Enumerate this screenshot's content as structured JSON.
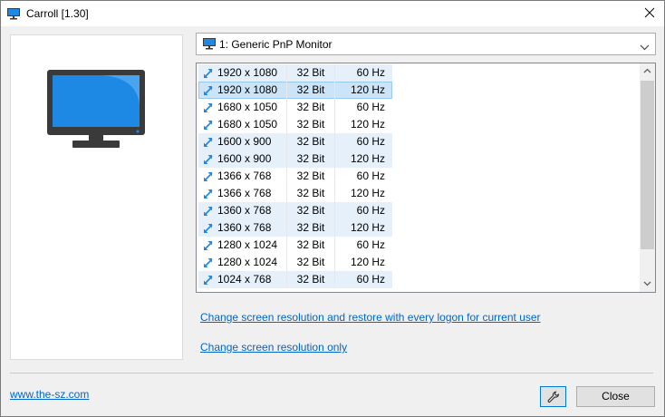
{
  "window": {
    "title": "Carroll [1.30]"
  },
  "monitor_select": {
    "selected": "1: Generic PnP Monitor"
  },
  "resolution_list": {
    "rows": [
      {
        "resolution": "1920 x 1080",
        "bits": "32 Bit",
        "hz": "60 Hz"
      },
      {
        "resolution": "1920 x 1080",
        "bits": "32 Bit",
        "hz": "120 Hz",
        "selected": true
      },
      {
        "resolution": "1680 x 1050",
        "bits": "32 Bit",
        "hz": "60 Hz"
      },
      {
        "resolution": "1680 x 1050",
        "bits": "32 Bit",
        "hz": "120 Hz"
      },
      {
        "resolution": "1600 x 900",
        "bits": "32 Bit",
        "hz": "60 Hz"
      },
      {
        "resolution": "1600 x 900",
        "bits": "32 Bit",
        "hz": "120 Hz"
      },
      {
        "resolution": "1366 x 768",
        "bits": "32 Bit",
        "hz": "60 Hz"
      },
      {
        "resolution": "1366 x 768",
        "bits": "32 Bit",
        "hz": "120 Hz"
      },
      {
        "resolution": "1360 x 768",
        "bits": "32 Bit",
        "hz": "60 Hz"
      },
      {
        "resolution": "1360 x 768",
        "bits": "32 Bit",
        "hz": "120 Hz"
      },
      {
        "resolution": "1280 x 1024",
        "bits": "32 Bit",
        "hz": "60 Hz"
      },
      {
        "resolution": "1280 x 1024",
        "bits": "32 Bit",
        "hz": "120 Hz"
      },
      {
        "resolution": "1024 x 768",
        "bits": "32 Bit",
        "hz": "60 Hz"
      }
    ]
  },
  "links": {
    "restore_each_logon": "Change screen resolution and restore with every logon for current user",
    "change_only": "Change screen resolution only",
    "website": "www.the-sz.com"
  },
  "buttons": {
    "close": "Close"
  },
  "icons": {
    "app": "monitor-icon",
    "row": "resize-arrow-icon",
    "settings": "wrench-icon",
    "window_close": "close-icon"
  },
  "colors": {
    "link": "#0066cc",
    "row_alt": "#e5f0fb",
    "row_selected": "#cce4f7",
    "monitor_screen": "#1e88e5",
    "monitor_body": "#3a3a3a"
  }
}
